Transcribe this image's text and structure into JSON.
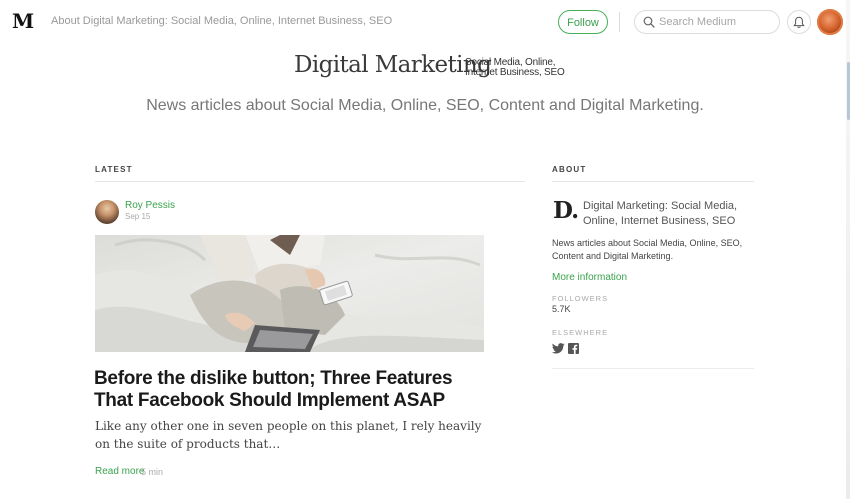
{
  "header": {
    "logo_letter": "M",
    "breadcrumb": "About Digital Marketing: Social Media, Online, Internet Business, SEO",
    "follow_label": "Follow",
    "search_placeholder": "Search Medium",
    "icons": [
      "search-icon",
      "bell-icon",
      "user-avatar"
    ]
  },
  "publication": {
    "title": "Digital Marketing",
    "tagline_line1": "Social Media, Online,",
    "tagline_line2": "Internet Business, SEO",
    "description": "News articles about Social Media, Online, SEO, Content and Digital Marketing."
  },
  "latest": {
    "heading": "LATEST",
    "post": {
      "author": "Roy Pessis",
      "date": "Sep 15",
      "title": "Before the dislike button; Three Features That Facebook Should Implement ASAP",
      "excerpt": "Like any other one in seven people on this planet, I rely heavily on the suite of products that…",
      "read_more": "Read more",
      "read_time": "5 min"
    }
  },
  "about": {
    "heading": "ABOUT",
    "logo_letter": "D.",
    "name": "Digital Marketing: Social Media, Online, Internet Business, SEO",
    "description": "News articles about Social Media, Online, SEO, Content and Digital Marketing.",
    "more_info": "More information",
    "followers_label": "FOLLOWERS",
    "followers_count": "5.7K",
    "elsewhere_label": "ELSEWHERE",
    "social_icons": [
      "twitter-icon",
      "facebook-icon"
    ]
  },
  "colors": {
    "accent": "#3aa24d",
    "text": "#333333",
    "muted": "#999999"
  }
}
